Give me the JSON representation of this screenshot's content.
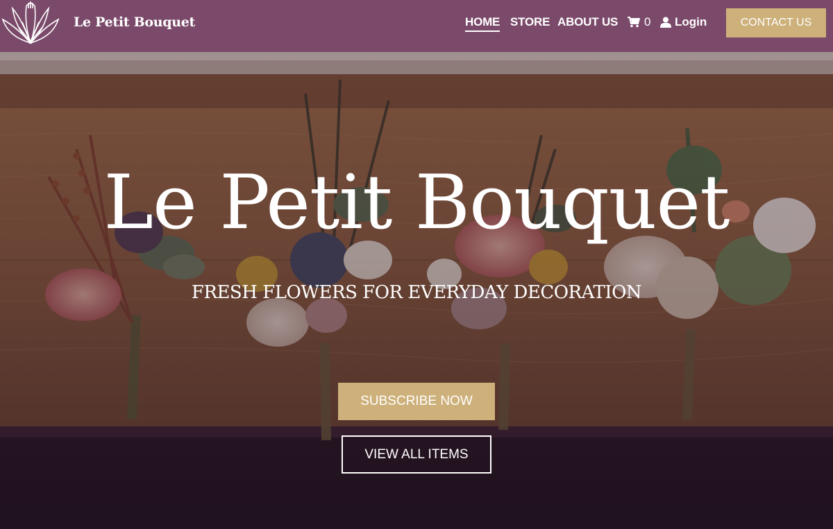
{
  "nav": {
    "brand": "Le Petit Bouquet",
    "links": [
      "HOME",
      "STORE",
      "ABOUT US"
    ],
    "cart_count": "0",
    "login_label": "Login",
    "contact_label": "CONTACT US",
    "logo_icon": "flower-logo-icon",
    "cart_icon": "cart-icon",
    "user_icon": "user-icon"
  },
  "hero": {
    "title": "Le Petit Bouquet",
    "subtitle": "FRESH FLOWERS FOR EVERYDAY DECORATION",
    "subscribe_label": "SUBSCRIBE NOW",
    "view_label": "VIEW ALL ITEMS"
  },
  "colors": {
    "nav_bg": "#7b4a6a",
    "accent": "#cdb07a",
    "text": "#ffffff"
  }
}
